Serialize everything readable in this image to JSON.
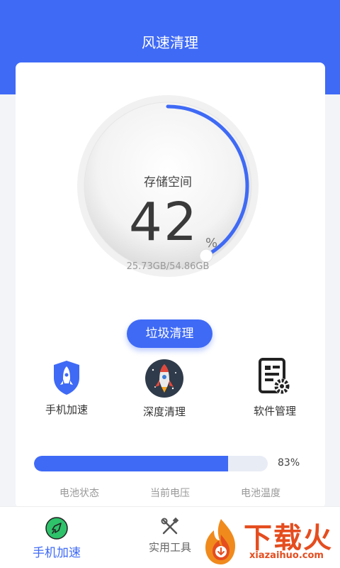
{
  "header": {
    "title": "风速清理"
  },
  "storage": {
    "label": "存储空间",
    "value": "42",
    "unit": "%",
    "detail": "25.73GB/54.86GB",
    "fraction": 0.42
  },
  "clean_button": {
    "label": "垃圾清理"
  },
  "functions": [
    {
      "label": "手机加速",
      "icon": "rocket-shield-icon"
    },
    {
      "label": "深度清理",
      "icon": "rocket-icon"
    },
    {
      "label": "软件管理",
      "icon": "app-settings-icon"
    }
  ],
  "battery": {
    "percent_label": "83%",
    "fraction": 0.83
  },
  "stats": [
    {
      "label": "电池状态",
      "value": ""
    },
    {
      "label": "当前电压",
      "value": ""
    },
    {
      "label": "电池温度",
      "value": ""
    }
  ],
  "tabs": [
    {
      "label": "手机加速",
      "icon": "rocket-icon",
      "active": true
    },
    {
      "label": "实用工具",
      "icon": "tools-icon",
      "active": false
    }
  ],
  "watermark": {
    "text": "下载火",
    "sub": "xiazaihuo.com"
  },
  "colors": {
    "primary": "#3f6af6",
    "watermark": "#e54d1f"
  }
}
